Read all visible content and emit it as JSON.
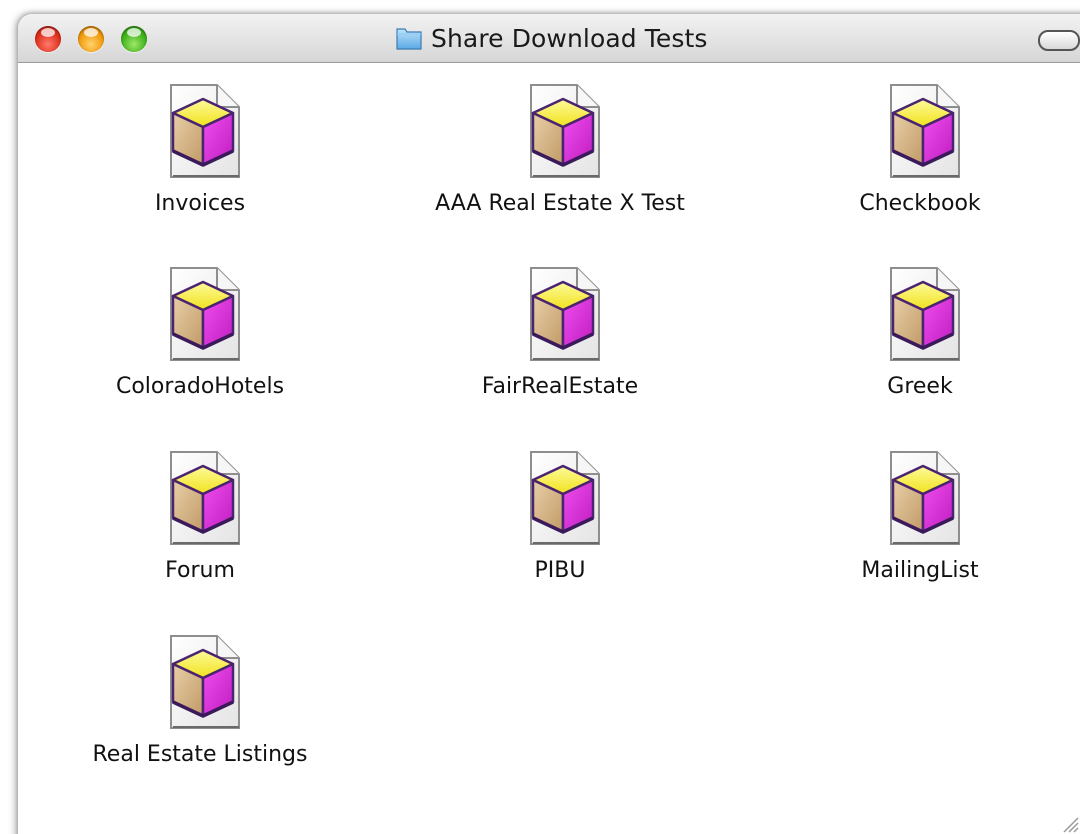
{
  "window": {
    "title": "Share Download Tests",
    "title_icon": "folder-icon",
    "buttons": {
      "close": "close-button",
      "minimize": "minimize-button",
      "zoom": "zoom-button"
    }
  },
  "files": [
    {
      "label": "Invoices",
      "icon": "database-document-icon"
    },
    {
      "label": "AAA Real Estate X Test",
      "icon": "database-document-icon"
    },
    {
      "label": "Checkbook",
      "icon": "database-document-icon"
    },
    {
      "label": "ColoradoHotels",
      "icon": "database-document-icon"
    },
    {
      "label": "FairRealEstate",
      "icon": "database-document-icon"
    },
    {
      "label": "Greek",
      "icon": "database-document-icon"
    },
    {
      "label": "Forum",
      "icon": "database-document-icon"
    },
    {
      "label": "PIBU",
      "icon": "database-document-icon"
    },
    {
      "label": "MailingList",
      "icon": "database-document-icon"
    },
    {
      "label": "Real Estate Listings",
      "icon": "database-document-icon"
    }
  ],
  "colors": {
    "cube_top": "#f6ef3a",
    "cube_left": "#d7b283",
    "cube_right": "#dc2ad8",
    "cube_edge": "#5a2a7a"
  }
}
